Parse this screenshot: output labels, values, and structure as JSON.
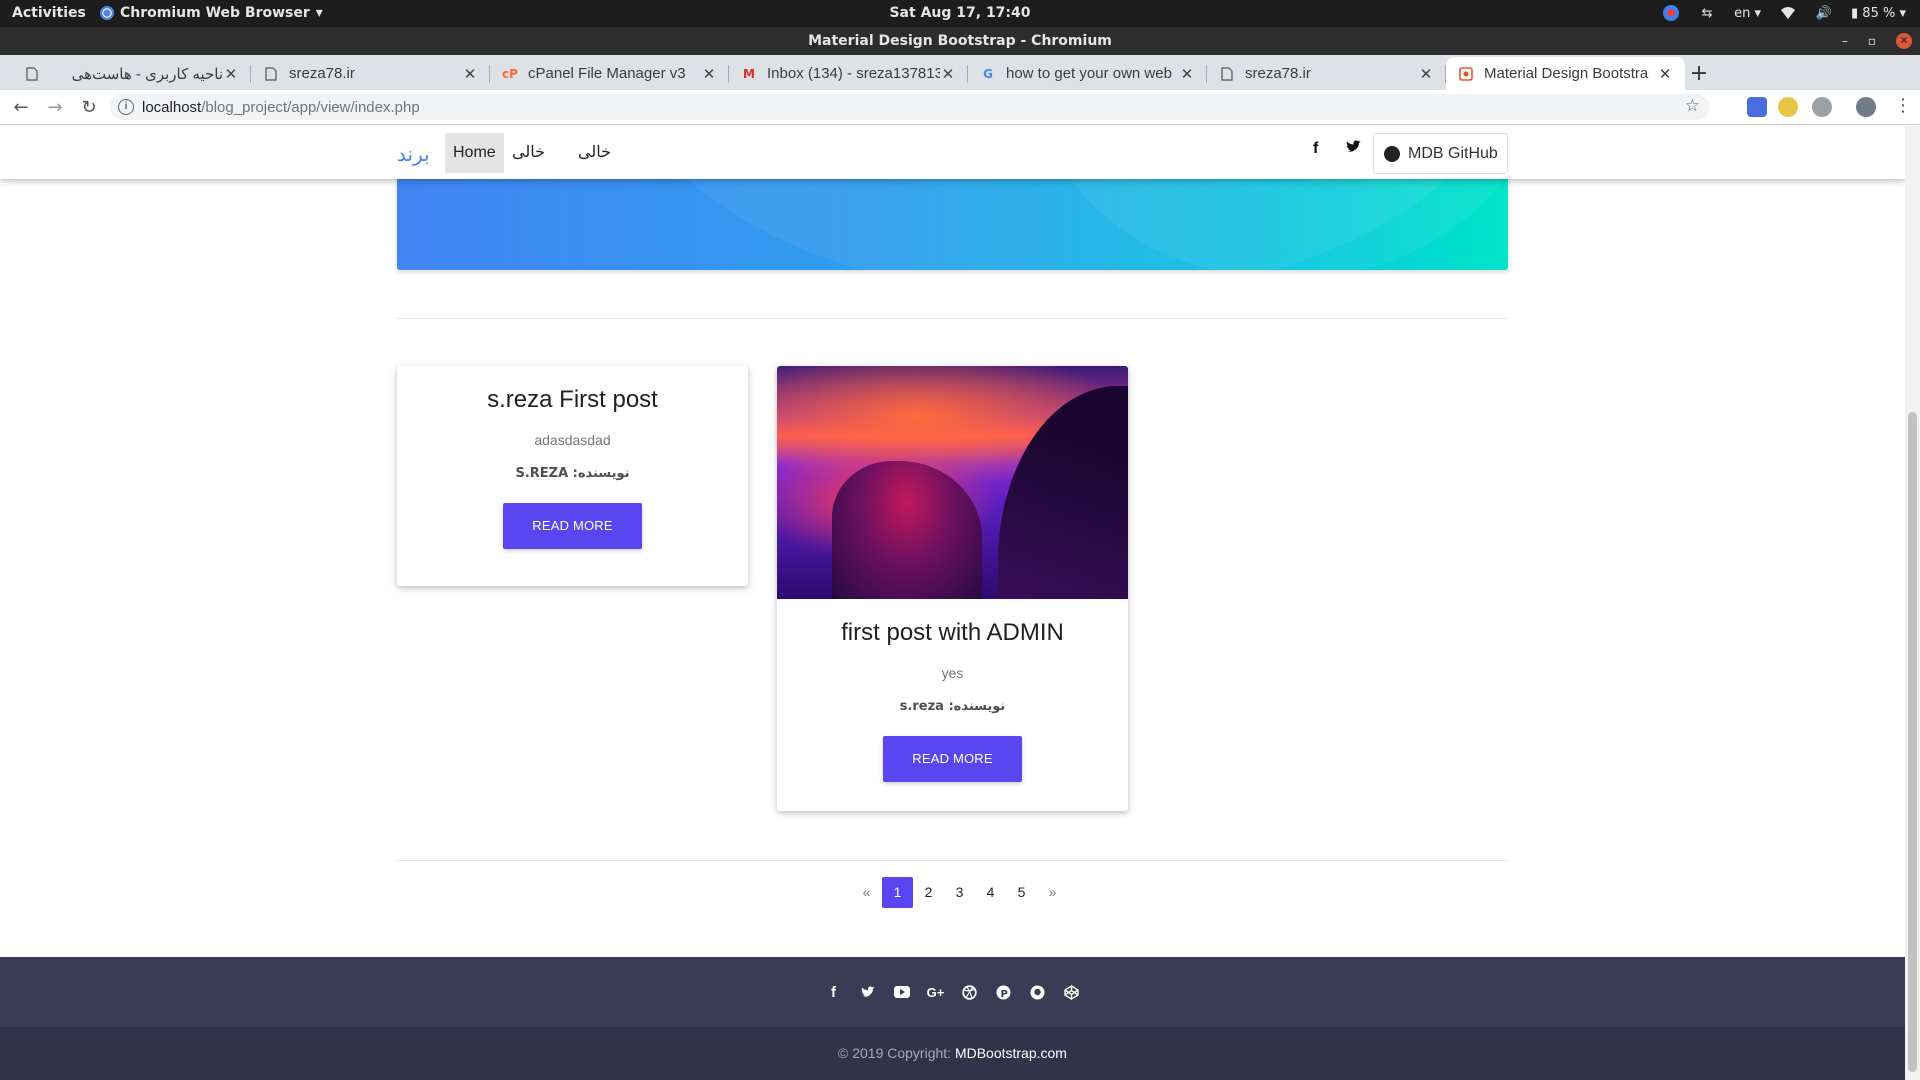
{
  "os_bar": {
    "activities": "Activities",
    "app_name": "Chromium Web Browser",
    "clock": "Sat Aug 17, 17:40",
    "language": "en",
    "battery": "85 %"
  },
  "window": {
    "title": "Material Design Bootstrap - Chromium"
  },
  "tabs": [
    {
      "label": "ناحیه کاربری - هاست‌هی",
      "icon": "page-icon"
    },
    {
      "label": "sreza78.ir",
      "icon": "page-icon"
    },
    {
      "label": "cPanel File Manager v3",
      "icon": "cpanel-icon"
    },
    {
      "label": "Inbox (134) - sreza137813",
      "icon": "gmail-icon"
    },
    {
      "label": "how to get your own web",
      "icon": "google-icon"
    },
    {
      "label": "sreza78.ir",
      "icon": "page-icon"
    },
    {
      "label": "Material Design Bootstra",
      "icon": "mdb-icon",
      "active": true
    }
  ],
  "address_bar": {
    "host": "localhost",
    "path": "/blog_project/app/view/index.php"
  },
  "site_nav": {
    "brand": "برند",
    "links": [
      "Home",
      "خالی",
      "خالی"
    ],
    "github_label": "MDB GitHub"
  },
  "posts": [
    {
      "title": "s.reza First post",
      "text": "adasdasdad",
      "author": "نویسنده: S.REZA",
      "button": "READ MORE",
      "has_image": false
    },
    {
      "title": "first post with ADMIN",
      "text": "yes",
      "author": "نویسنده: s.reza",
      "button": "READ MORE",
      "has_image": true
    }
  ],
  "pagination": {
    "prev": "«",
    "pages": [
      "1",
      "2",
      "3",
      "4",
      "5"
    ],
    "current": "1",
    "next": "»"
  },
  "footer": {
    "social_icons": [
      "facebook-icon",
      "twitter-icon",
      "youtube-icon",
      "google-plus-icon",
      "dribbble-icon",
      "pinterest-icon",
      "github-icon",
      "codepen-icon"
    ],
    "copyright_prefix": "© 2019 Copyright:",
    "copyright_link": "MDBootstrap.com"
  },
  "colors": {
    "accent": "#5a46f0",
    "brand": "#4285f4",
    "footer": "#3b3b56"
  }
}
